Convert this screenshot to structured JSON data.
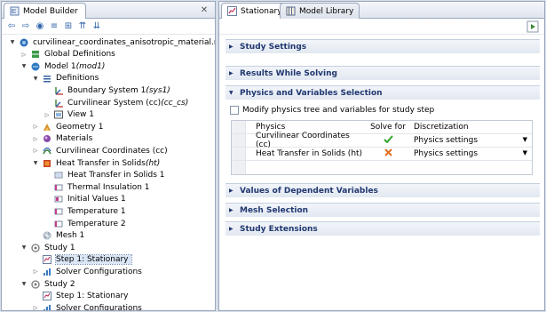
{
  "left_panel": {
    "title": "Model Builder",
    "tree": [
      {
        "label": "curvilinear_coordinates_anisotropic_material.mph (",
        "depth": 0,
        "arrow": "down",
        "icon": "root-icon"
      },
      {
        "label": "Global Definitions",
        "depth": 1,
        "arrow": "right",
        "icon": "globe-icon"
      },
      {
        "label": "Model 1 ",
        "italic": "(mod1)",
        "depth": 1,
        "arrow": "down",
        "icon": "model-icon"
      },
      {
        "label": "Definitions",
        "depth": 2,
        "arrow": "down",
        "icon": "definitions-icon"
      },
      {
        "label": "Boundary System 1 ",
        "italic": "(sys1)",
        "depth": 3,
        "arrow": "",
        "icon": "coordsys-icon"
      },
      {
        "label": "Curvilinear System (cc) ",
        "italic": "(cc_cs)",
        "depth": 3,
        "arrow": "",
        "icon": "coordsys-icon"
      },
      {
        "label": "View 1",
        "depth": 3,
        "arrow": "right",
        "icon": "view-icon"
      },
      {
        "label": "Geometry 1",
        "depth": 2,
        "arrow": "right",
        "icon": "geometry-icon"
      },
      {
        "label": "Materials",
        "depth": 2,
        "arrow": "right",
        "icon": "materials-icon"
      },
      {
        "label": "Curvilinear Coordinates (cc)",
        "depth": 2,
        "arrow": "right",
        "icon": "curvilinear-icon"
      },
      {
        "label": "Heat Transfer in Solids ",
        "italic": "(ht)",
        "depth": 2,
        "arrow": "down",
        "icon": "heat-transfer-icon"
      },
      {
        "label": "Heat Transfer in Solids 1",
        "depth": 3,
        "arrow": "",
        "icon": "ht-node-icon"
      },
      {
        "label": "Thermal Insulation 1",
        "depth": 3,
        "arrow": "",
        "icon": "boundary-node-icon"
      },
      {
        "label": "Initial Values 1",
        "depth": 3,
        "arrow": "",
        "icon": "domain-node-icon"
      },
      {
        "label": "Temperature 1",
        "depth": 3,
        "arrow": "",
        "icon": "boundary-node-icon"
      },
      {
        "label": "Temperature 2",
        "depth": 3,
        "arrow": "",
        "icon": "boundary-node-icon"
      },
      {
        "label": "Mesh 1",
        "depth": 2,
        "arrow": "",
        "icon": "mesh-icon"
      },
      {
        "label": "Study 1",
        "depth": 1,
        "arrow": "down",
        "icon": "study-icon"
      },
      {
        "label": "Step 1: Stationary",
        "depth": 2,
        "arrow": "",
        "icon": "stationary-icon",
        "selected": true
      },
      {
        "label": "Solver Configurations",
        "depth": 2,
        "arrow": "right",
        "icon": "solver-icon"
      },
      {
        "label": "Study 2",
        "depth": 1,
        "arrow": "down",
        "icon": "study-icon"
      },
      {
        "label": "Step 1: Stationary",
        "depth": 2,
        "arrow": "",
        "icon": "stationary-icon"
      },
      {
        "label": "Solver Configurations",
        "depth": 2,
        "arrow": "right",
        "icon": "solver-icon"
      }
    ]
  },
  "right_panel": {
    "tabs": [
      {
        "label": "Stationary",
        "active": true
      },
      {
        "label": "Model Library",
        "active": false
      }
    ],
    "sections": {
      "study_settings": "Study Settings",
      "results_while_solving": "Results While Solving",
      "physics_selection": "Physics and Variables Selection",
      "dependent_values": "Values of Dependent Variables",
      "mesh_selection": "Mesh Selection",
      "study_extensions": "Study Extensions"
    },
    "modify_checkbox_label": "Modify physics tree and variables for study step",
    "physics_table": {
      "headers": [
        "Physics",
        "Solve for",
        "Discretization"
      ],
      "rows": [
        {
          "physics": "Curvilinear Coordinates (cc)",
          "solve_for": true,
          "discretization": "Physics settings"
        },
        {
          "physics": "Heat Transfer in Solids (ht)",
          "solve_for": false,
          "discretization": "Physics settings"
        }
      ]
    }
  },
  "colors": {
    "section_text": "#203870",
    "check_green": "#2fa52f",
    "cross_orange": "#e07020",
    "selection_bg": "#dbe6f5"
  }
}
